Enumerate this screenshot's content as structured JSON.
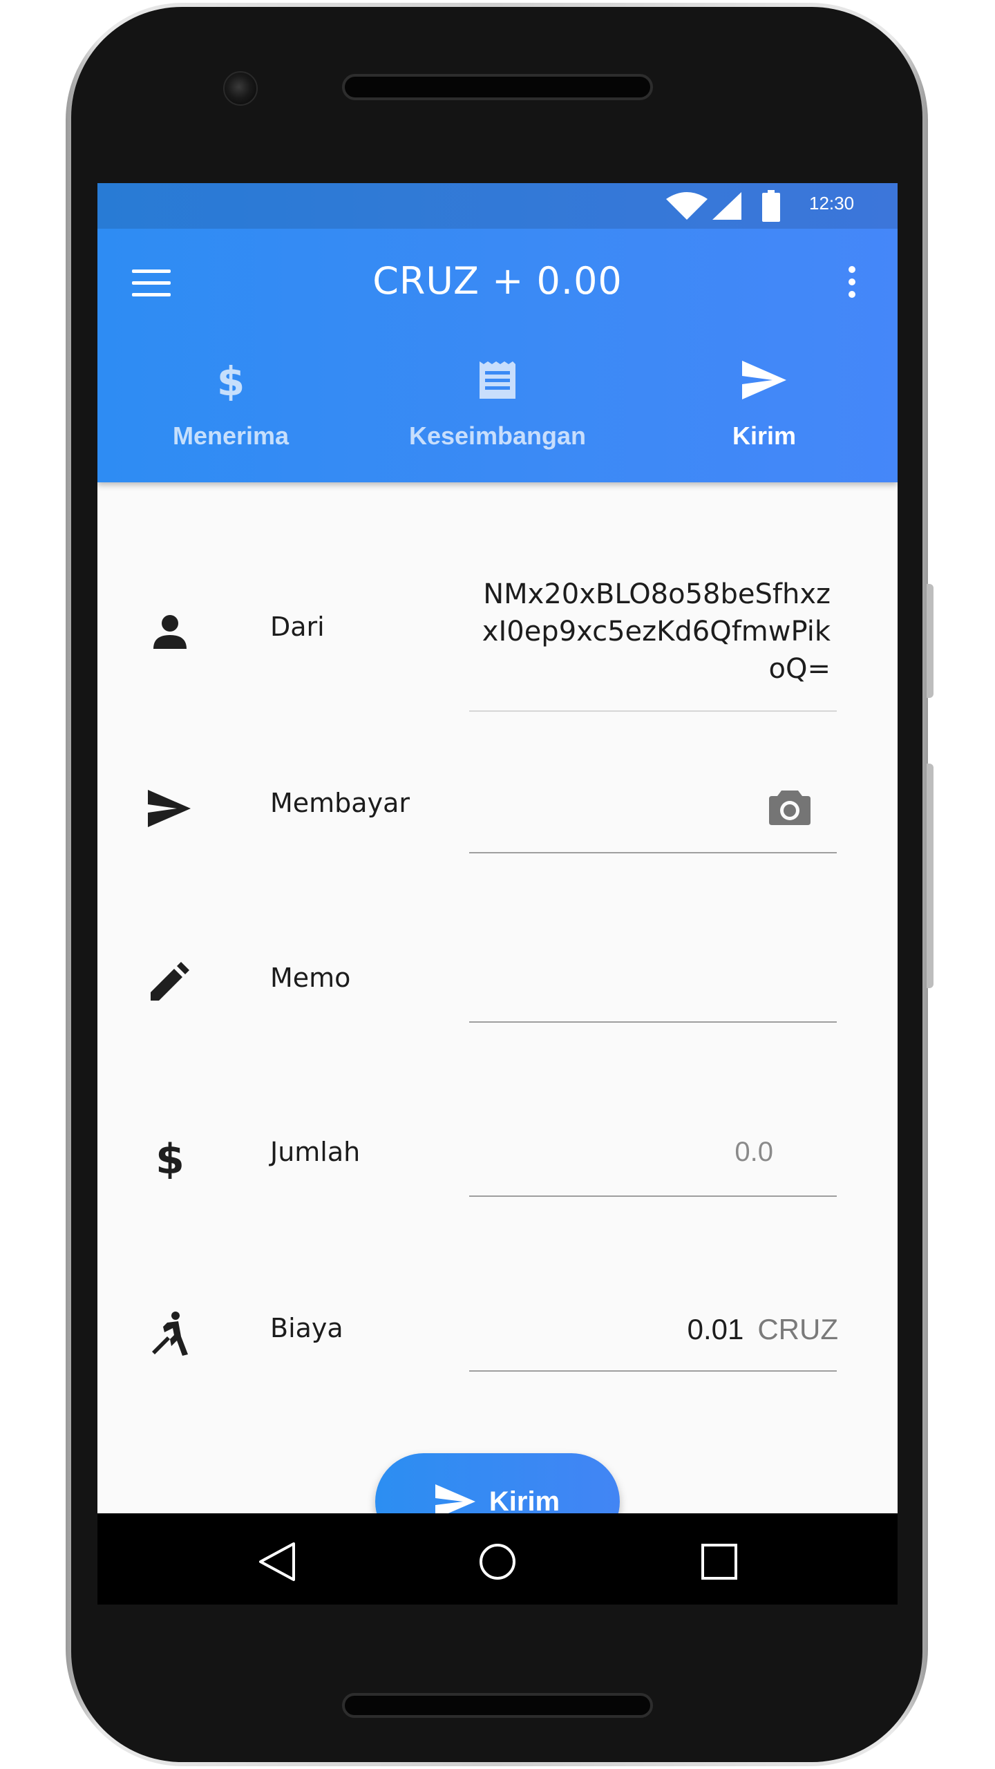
{
  "status_bar": {
    "time": "12:30"
  },
  "toolbar": {
    "title": "CRUZ + 0.00"
  },
  "tabs": [
    {
      "label": "Menerima",
      "icon": "dollar-icon",
      "active": false
    },
    {
      "label": "Keseimbangan",
      "icon": "receipt-icon",
      "active": false
    },
    {
      "label": "Kirim",
      "icon": "send-icon",
      "active": true
    }
  ],
  "form": {
    "from": {
      "label": "Dari",
      "value": "NMx20xBLO8o58beSfhxzxI0ep9xc5ezKd6QfmwPikoQ="
    },
    "pay_to": {
      "label": "Membayar",
      "value": ""
    },
    "memo": {
      "label": "Memo",
      "value": ""
    },
    "amount": {
      "label": "Jumlah",
      "placeholder": "0.0"
    },
    "fee": {
      "label": "Biaya",
      "value": "0.01",
      "unit": "CRUZ"
    }
  },
  "send_button": {
    "label": "Kirim"
  },
  "colors": {
    "primary": "#3b8af5",
    "primary_light": "#2e8cf3",
    "background": "#fafafa"
  }
}
